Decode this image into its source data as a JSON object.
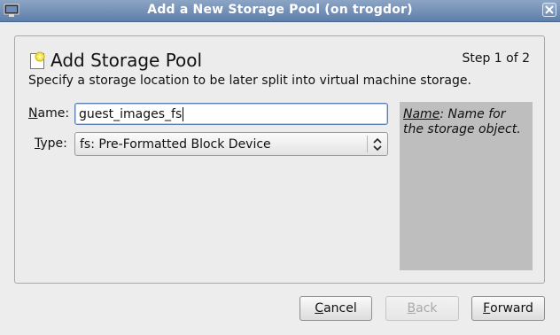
{
  "window": {
    "title": "Add a New Storage Pool (on trogdor)"
  },
  "header": {
    "title": "Add Storage Pool",
    "step": "Step 1 of 2",
    "description": "Specify a storage location to be later split into virtual machine storage."
  },
  "form": {
    "name_label_key": "N",
    "name_label_rest": "ame:",
    "name_value": "guest_images_fs",
    "type_label_key": "T",
    "type_label_rest": "ype:",
    "type_value": "fs: Pre-Formatted Block Device"
  },
  "help": {
    "term": "Name",
    "text": ": Name for the storage object."
  },
  "buttons": {
    "cancel_key": "C",
    "cancel_rest": "ancel",
    "back_key": "B",
    "back_rest": "ack",
    "forward_key": "F",
    "forward_rest": "orward"
  },
  "icons": {
    "window_icon": "monitor-icon",
    "close_icon": "close-icon",
    "header_icon": "new-storage-icon",
    "select_arrows": "updown-arrows-icon"
  }
}
